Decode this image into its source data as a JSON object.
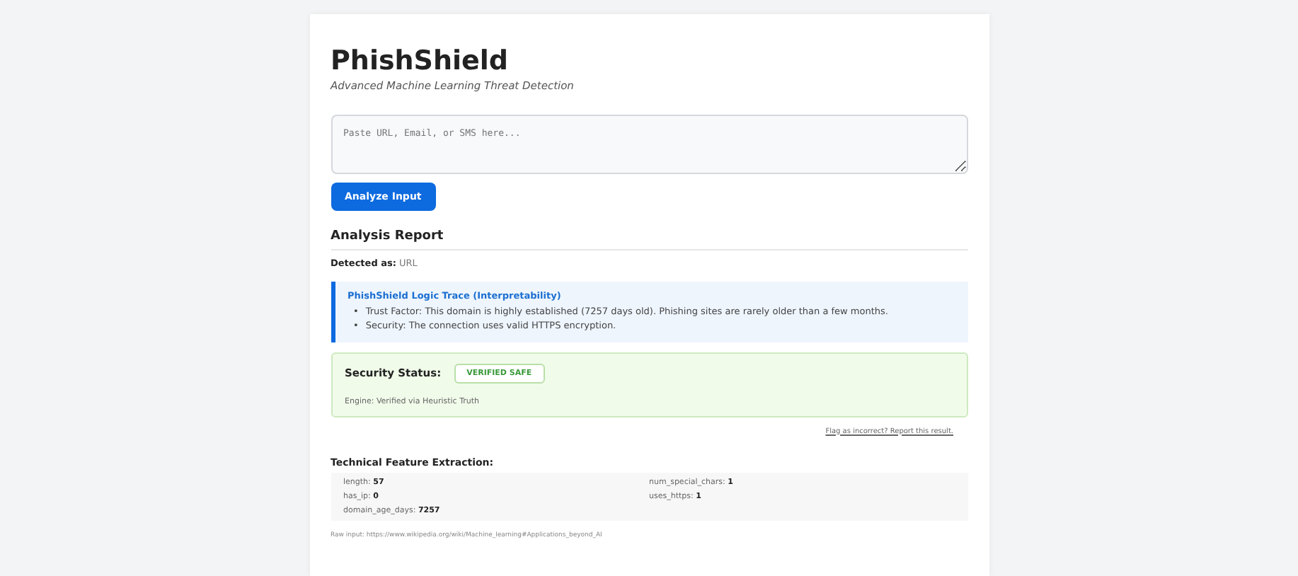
{
  "title": "PhishShield",
  "subtitle": "Advanced Machine Learning Threat Detection",
  "input": {
    "placeholder": "Paste URL, Email, or SMS here..."
  },
  "analyze_button": "Analyze Input",
  "report": {
    "heading": "Analysis Report",
    "detected_label": "Detected as:",
    "detected_value": "URL",
    "trace": {
      "title": "PhishShield Logic Trace (Interpretability)",
      "items": [
        {
          "bullet": "•",
          "text": "Trust Factor: This domain is highly established (7257 days old). Phishing sites are rarely older than a few months."
        },
        {
          "bullet": "•",
          "text": "Security: The connection uses valid HTTPS encryption."
        }
      ]
    },
    "status": {
      "label": "Security Status:",
      "badge": "VERIFIED SAFE",
      "safe": true,
      "engine": "Engine: Verified via Heuristic Truth"
    },
    "report_link": "Flag as incorrect? Report this result.",
    "features": {
      "heading": "Technical Feature Extraction:",
      "items": [
        {
          "name": "length:",
          "value": "57"
        },
        {
          "name": "num_special_chars:",
          "value": "1"
        },
        {
          "name": "has_ip:",
          "value": "0"
        },
        {
          "name": "uses_https:",
          "value": "1"
        },
        {
          "name": "domain_age_days:",
          "value": "7257"
        }
      ]
    },
    "raw_input": "Raw input: https://www.wikipedia.org/wiki/Machine_learning#Applications_beyond_AI"
  }
}
